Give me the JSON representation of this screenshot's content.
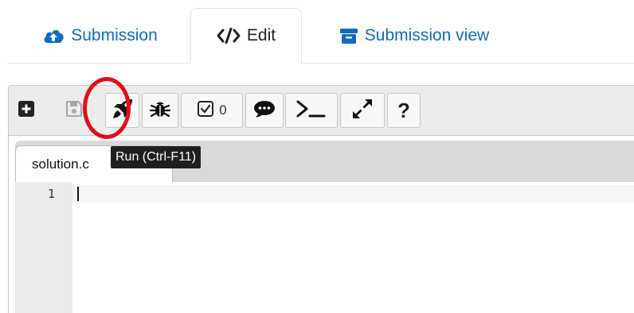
{
  "tabs": {
    "items": [
      {
        "label": "Submission",
        "icon": "cloud-upload-icon"
      },
      {
        "label": "Edit",
        "icon": "code-icon",
        "active": true
      },
      {
        "label": "Submission view",
        "icon": "archive-icon"
      }
    ]
  },
  "toolbar": {
    "buttons": [
      {
        "name": "new-file",
        "icon": "plus-square-icon"
      },
      {
        "name": "save",
        "icon": "floppy-disk-icon",
        "disabled": true
      },
      {
        "name": "run",
        "icon": "rocket-icon"
      },
      {
        "name": "debug",
        "icon": "bug-icon"
      },
      {
        "name": "evaluate",
        "icon": "check-square-icon"
      },
      {
        "name": "comments",
        "icon": "speech-bubble-icon"
      },
      {
        "name": "console",
        "icon": "terminal-icon"
      },
      {
        "name": "fullscreen",
        "icon": "expand-icon"
      },
      {
        "name": "help",
        "icon": "question-icon"
      }
    ],
    "evaluate_count": "0",
    "help_label": "?"
  },
  "tooltip": {
    "text": "Run (Ctrl-F11)"
  },
  "editor": {
    "file_tab": "solution.c",
    "line_numbers": [
      "1"
    ]
  },
  "colors": {
    "link_blue": "#0f6cbf",
    "highlight_red": "#e20d17",
    "toolbar_bg": "#ececec",
    "tooltip_bg": "#1f1f1f"
  }
}
